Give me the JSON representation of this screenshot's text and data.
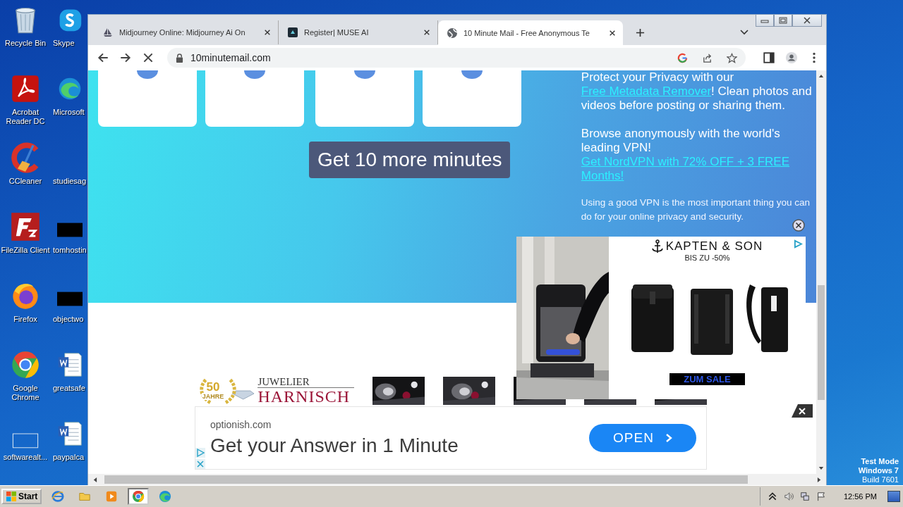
{
  "desktop": {
    "icons": [
      {
        "label": "Recycle Bin",
        "kind": "bin"
      },
      {
        "label": "Skype",
        "kind": "skype"
      },
      {
        "label": "Acrobat Reader DC",
        "kind": "acrobat"
      },
      {
        "label": "Microsoft",
        "kind": "edge"
      },
      {
        "label": "CCleaner",
        "kind": "ccleaner"
      },
      {
        "label": "studiesag",
        "kind": "none"
      },
      {
        "label": "FileZilla Client",
        "kind": "filezilla"
      },
      {
        "label": "tomhostin",
        "kind": "redacted"
      },
      {
        "label": "Firefox",
        "kind": "firefox"
      },
      {
        "label": "objectwo",
        "kind": "redacted"
      },
      {
        "label": "Google Chrome",
        "kind": "chrome"
      },
      {
        "label": "greatsafe",
        "kind": "word"
      },
      {
        "label": "softwarealt...",
        "kind": "blank"
      },
      {
        "label": "paypalca",
        "kind": "word"
      }
    ]
  },
  "browser": {
    "tabs": [
      {
        "title": "Midjourney Online: Midjourney Ai On",
        "kind": "sail",
        "selected": false
      },
      {
        "title": "Register| MUSE AI",
        "kind": "square",
        "selected": false
      },
      {
        "title": "10 Minute Mail - Free Anonymous Te",
        "kind": "globe",
        "selected": true
      }
    ],
    "address": "10minutemail.com"
  },
  "page": {
    "button": "Get 10 more minutes",
    "privacy": {
      "before": "Protect your Privacy with our ",
      "link": "Free Metadata Remover",
      "after": "! Clean photos and videos before posting or sharing them."
    },
    "vpn": {
      "text": "Browse anonymously with the world's leading VPN!",
      "link": "Get NordVPN with 72% OFF + 3 FREE Months!"
    },
    "note": "Using a good VPN is the most important thing you can do for your online privacy and security."
  },
  "ads": {
    "kapten": {
      "brand": "KAPTEN & SON",
      "offer": "BIS ZU -50%",
      "cta": "ZUM SALE"
    },
    "jeweler": {
      "years": "50",
      "years_label": "JAHRE",
      "name_top": "JUWELIER",
      "name": "HARNISCH"
    },
    "banner": {
      "domain": "optionish.com",
      "headline": "Get your Answer in 1 Minute",
      "cta": "OPEN"
    }
  },
  "os_notice": [
    "Test Mode",
    "Windows 7",
    "Build 7601"
  ],
  "taskbar": {
    "start": "Start",
    "apps": [
      {
        "kind": "ie",
        "selected": false
      },
      {
        "kind": "folder",
        "selected": false
      },
      {
        "kind": "media",
        "selected": false
      },
      {
        "kind": "chrome",
        "selected": true
      },
      {
        "kind": "edge",
        "selected": false
      }
    ],
    "clock": "12:56 PM"
  }
}
